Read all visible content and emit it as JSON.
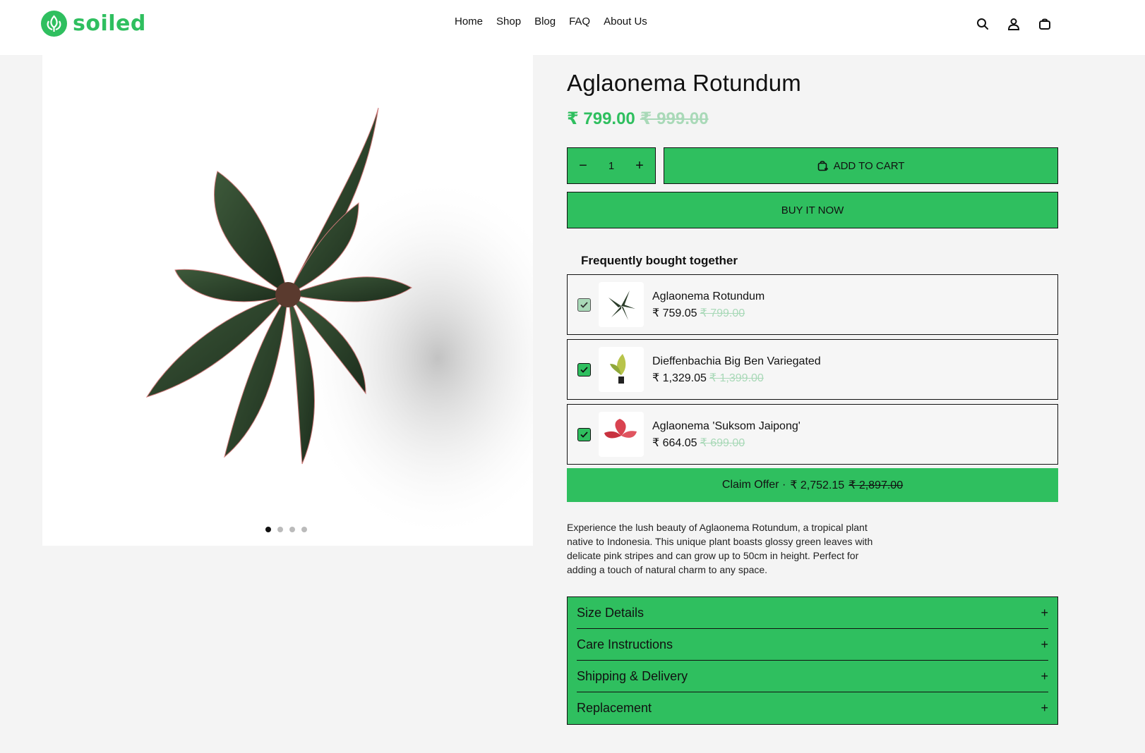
{
  "header": {
    "brand": "soiled",
    "nav": [
      "Home",
      "Shop",
      "Blog",
      "FAQ",
      "About Us"
    ],
    "icons": [
      "search-icon",
      "account-icon",
      "cart-icon"
    ]
  },
  "gallery": {
    "slide_count": 4,
    "active_slide": 1
  },
  "product": {
    "title": "Aglaonema Rotundum",
    "price": "₹ 799.00",
    "compare_price": "₹ 999.00",
    "quantity": "1",
    "add_to_cart_label": "ADD TO CART",
    "buy_now_label": "BUY IT NOW",
    "description": "Experience the lush beauty of Aglaonema Rotundum, a tropical plant native to Indonesia. This unique plant boasts glossy green leaves with delicate pink stripes and can grow up to 50cm in height. Perfect for adding a touch of natural charm to any space."
  },
  "fbt": {
    "title": "Frequently bought together",
    "items": [
      {
        "name": "Aglaonema Rotundum",
        "price": "₹ 759.05",
        "compare": "₹ 799.00",
        "checked": true
      },
      {
        "name": "Dieffenbachia Big Ben Variegated",
        "price": "₹ 1,329.05",
        "compare": "₹ 1,399.00",
        "checked": true
      },
      {
        "name": "Aglaonema 'Suksom Jaipong'",
        "price": "₹ 664.05",
        "compare": "₹ 699.00",
        "checked": true
      }
    ],
    "claim_label": "Claim Offer ·",
    "claim_price": "₹ 2,752.15",
    "claim_compare": "₹ 2,897.00"
  },
  "accordion": [
    "Size Details",
    "Care Instructions",
    "Shipping & Delivery",
    "Replacement"
  ],
  "colors": {
    "accent": "#2fbf5f",
    "accent_muted": "#a9d9b8",
    "border": "#111111",
    "background": "#f4f4f4"
  }
}
